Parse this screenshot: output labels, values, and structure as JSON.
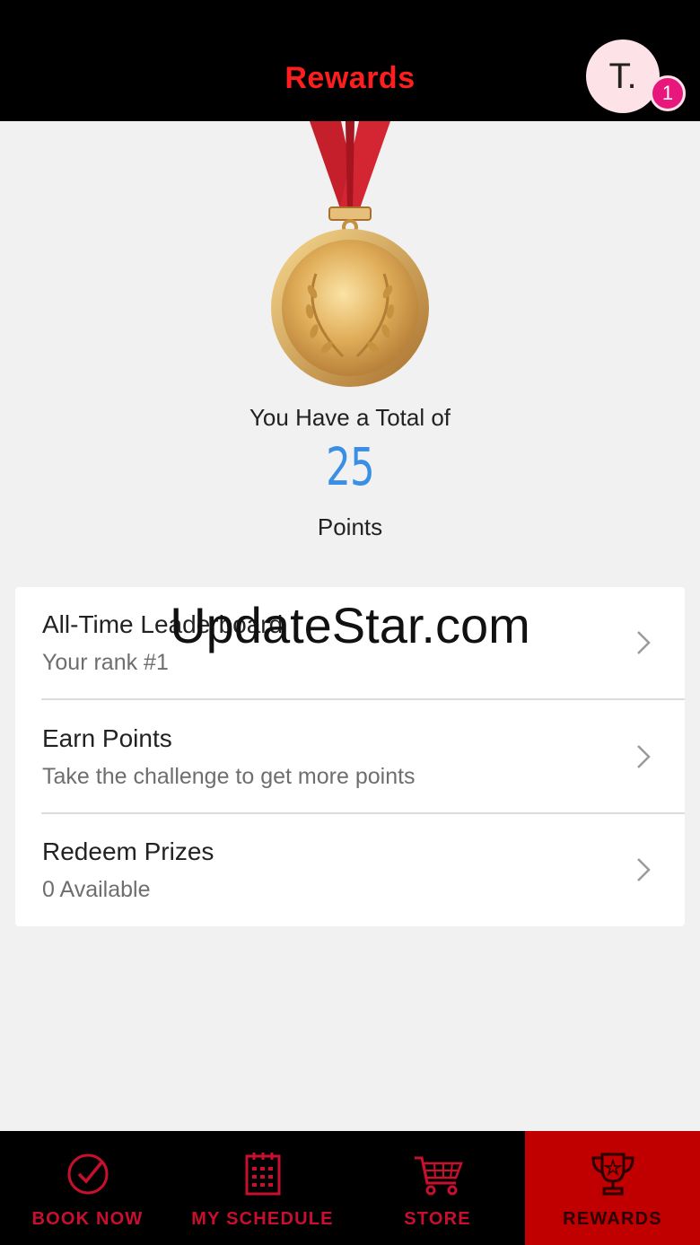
{
  "header": {
    "title": "Rewards",
    "avatar_initial": "T.",
    "notification_count": "1"
  },
  "summary": {
    "total_label": "You Have a Total of",
    "points": "25",
    "points_label": "Points"
  },
  "menu": [
    {
      "title": "All-Time Leaderboard",
      "subtitle": "Your rank #1"
    },
    {
      "title": "Earn Points",
      "subtitle": "Take the challenge to get more points"
    },
    {
      "title": "Redeem Prizes",
      "subtitle": "0 Available"
    }
  ],
  "watermark": "UpdateStar.com",
  "nav": [
    {
      "label": "BOOK NOW",
      "icon": "check-circle-icon"
    },
    {
      "label": "MY SCHEDULE",
      "icon": "calendar-icon"
    },
    {
      "label": "STORE",
      "icon": "cart-icon"
    },
    {
      "label": "REWARDS",
      "icon": "trophy-icon",
      "active": true
    }
  ],
  "colors": {
    "header_bg": "#000000",
    "accent_red": "#ff1e1e",
    "points_blue": "#3a8ee6",
    "badge_pink": "#e7177b",
    "nav_active": "#c00000"
  }
}
